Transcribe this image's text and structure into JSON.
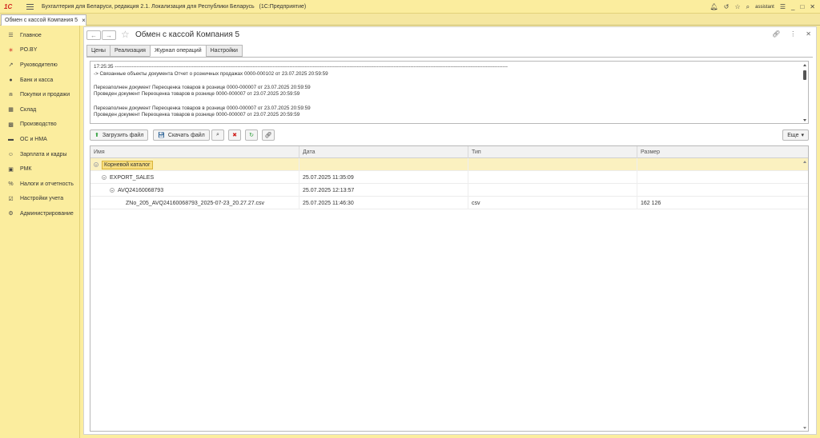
{
  "app": {
    "logo": "1С",
    "title": "Бухгалтерия для Беларуси, редакция 2.1. Локализация для Республики Беларусь",
    "platform": "(1С:Предприятие)",
    "user": "assistant"
  },
  "tab": {
    "label": "Обмен с кассой Компания 5",
    "close": "×"
  },
  "sidebar": {
    "items": [
      {
        "label": "Главное",
        "icon": "menu-icon"
      },
      {
        "label": "PO.BY",
        "icon": "asterisk-icon"
      },
      {
        "label": "Руководителю",
        "icon": "trend-icon"
      },
      {
        "label": "Банк и касса",
        "icon": "coins-icon"
      },
      {
        "label": "Покупки и продажи",
        "icon": "cart-icon"
      },
      {
        "label": "Склад",
        "icon": "warehouse-icon"
      },
      {
        "label": "Производство",
        "icon": "factory-icon"
      },
      {
        "label": "ОС и НМА",
        "icon": "truck-icon"
      },
      {
        "label": "Зарплата и кадры",
        "icon": "people-icon"
      },
      {
        "label": "РМК",
        "icon": "register-icon"
      },
      {
        "label": "Налоги и отчетность",
        "icon": "percent-icon"
      },
      {
        "label": "Настройки учета",
        "icon": "checklist-icon"
      },
      {
        "label": "Администрирование",
        "icon": "gear-icon"
      }
    ]
  },
  "form": {
    "title": "Обмен с кассой Компания 5",
    "tabs": [
      {
        "label": "Цены"
      },
      {
        "label": "Реализация"
      },
      {
        "label": "Журнал операций"
      },
      {
        "label": "Настройки"
      }
    ],
    "log_lines": [
      "17:25:35 ------------------------------------------------------------------------------------------------------------------------------------------------------------------------------------------------------------------------------------------",
      "-> Связанные объекты документа Отчет о розничных продажах 0000-000102 от 23.07.2025 20:59:59",
      "",
      "Перезаполнен документ Переоценка товаров в рознице 0000-000007 от 23.07.2025 20:59:59",
      "Проведен документ Переоценка товаров в рознице 0000-000007 от 23.07.2025 20:59:59",
      "",
      "Перезаполнен документ Переоценка товаров в рознице 0000-000007 от 23.07.2025 20:59:59",
      "Проведен документ Переоценка товаров в рознице 0000-000007 от 23.07.2025 20:59:59"
    ],
    "toolbar": {
      "upload_label": "Загрузить файл",
      "download_label": "Скачать файл",
      "more_label": "Еще"
    },
    "grid": {
      "columns": [
        "Имя",
        "Дата",
        "Тип",
        "Размер"
      ],
      "rows": [
        {
          "name": "Корневой каталог",
          "date": "",
          "type": "",
          "size": ""
        },
        {
          "name": "EXPORT_SALES",
          "date": "25.07.2025 11:35:09",
          "type": "",
          "size": ""
        },
        {
          "name": "AVQ24160068793",
          "date": "25.07.2025 12:13:57",
          "type": "",
          "size": ""
        },
        {
          "name": "ZNo_205_AVQ24160068793_2025-07-23_20.27.27.csv",
          "date": "25.07.2025 11:46:30",
          "type": "csv",
          "size": "162 126"
        }
      ]
    }
  }
}
